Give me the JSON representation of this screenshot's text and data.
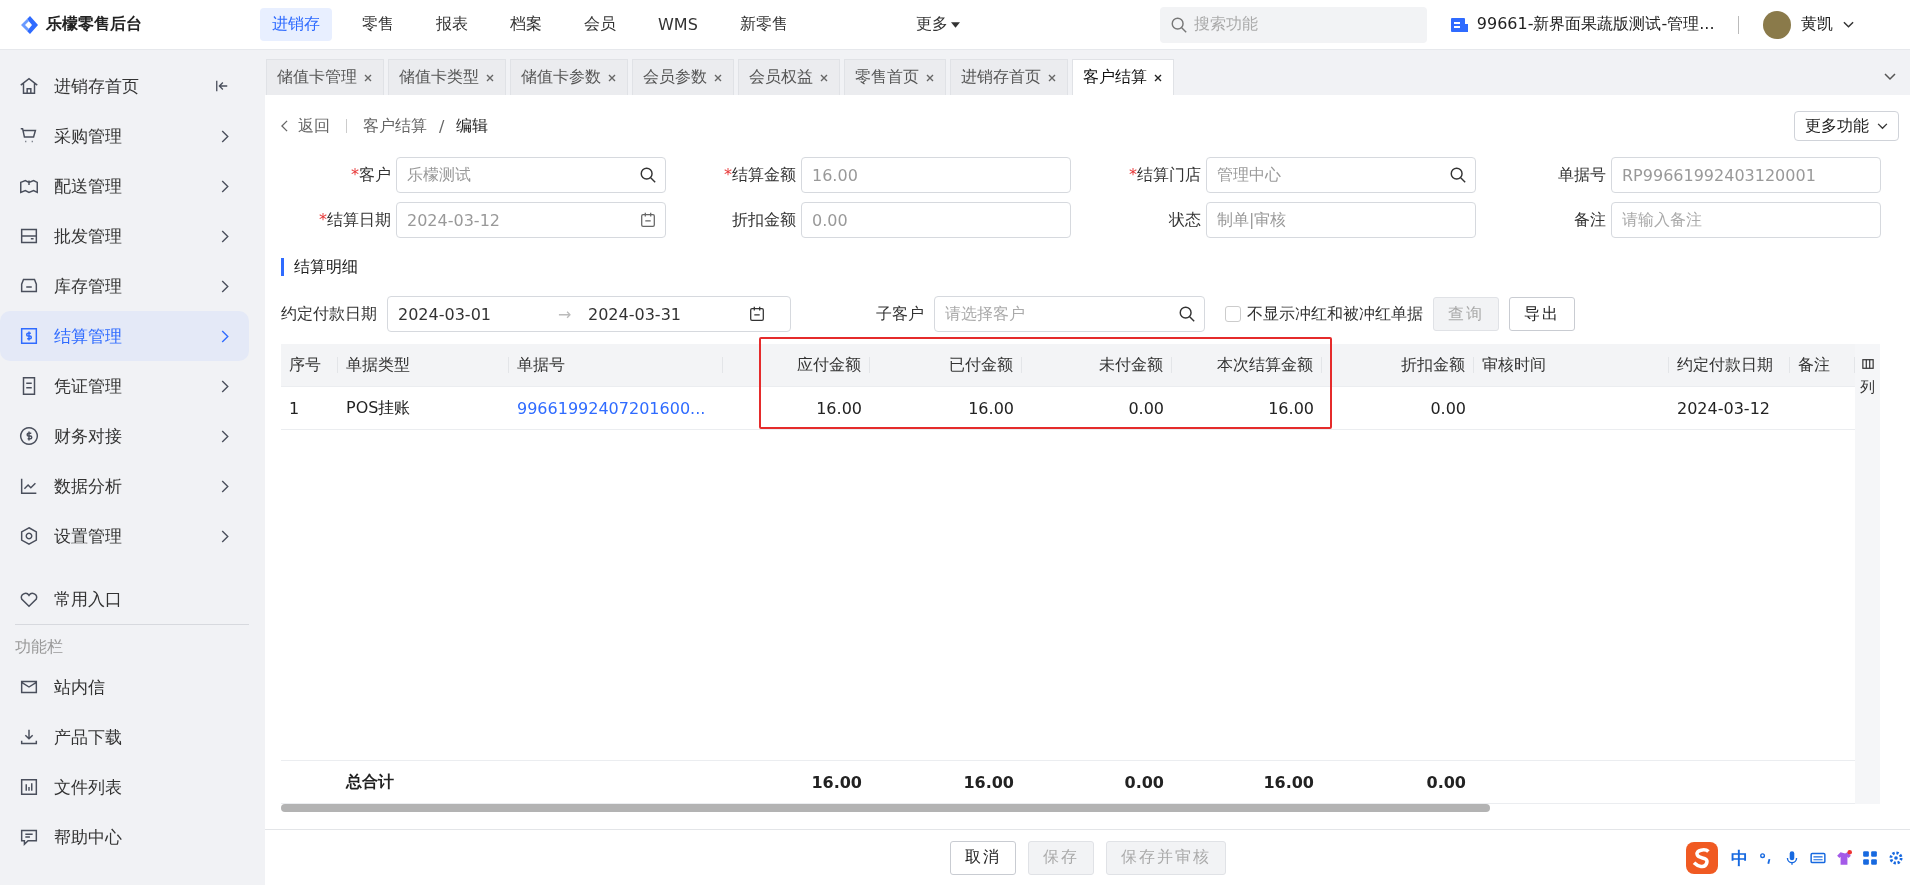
{
  "app": {
    "name": "乐檬零售后台"
  },
  "nav": [
    {
      "label": "进销存",
      "selected": true
    },
    {
      "label": "零售",
      "selected": false
    },
    {
      "label": "报表",
      "selected": false
    },
    {
      "label": "档案",
      "selected": false
    },
    {
      "label": "会员",
      "selected": false
    },
    {
      "label": "WMS",
      "selected": false
    },
    {
      "label": "新零售",
      "selected": false
    }
  ],
  "nav_more": "更多",
  "search": {
    "placeholder": "搜索功能"
  },
  "store": "99661-新界面果蔬版测试-管理...",
  "user": "黄凯",
  "tabs": [
    {
      "label": "储值卡管理",
      "selected": false
    },
    {
      "label": "储值卡类型",
      "selected": false
    },
    {
      "label": "储值卡参数",
      "selected": false
    },
    {
      "label": "会员参数",
      "selected": false
    },
    {
      "label": "会员权益",
      "selected": false
    },
    {
      "label": "零售首页",
      "selected": false
    },
    {
      "label": "进销存首页",
      "selected": false
    },
    {
      "label": "客户结算",
      "selected": true
    }
  ],
  "sidebar": {
    "home": "进销存首页",
    "items": [
      {
        "label": "采购管理",
        "selected": false
      },
      {
        "label": "配送管理",
        "selected": false
      },
      {
        "label": "批发管理",
        "selected": false
      },
      {
        "label": "库存管理",
        "selected": false
      },
      {
        "label": "结算管理",
        "selected": true
      },
      {
        "label": "凭证管理",
        "selected": false
      },
      {
        "label": "财务对接",
        "selected": false
      },
      {
        "label": "数据分析",
        "selected": false
      },
      {
        "label": "设置管理",
        "selected": false
      }
    ],
    "favorites": "常用入口",
    "tools_heading": "功能栏",
    "tools": [
      "站内信",
      "产品下载",
      "文件列表",
      "帮助中心"
    ]
  },
  "breadcrumb": {
    "back": "返回",
    "path": "客户结算",
    "separator": "/",
    "current": "编辑"
  },
  "more_button": "更多功能",
  "required_mark": "*",
  "form": [
    {
      "label": "客户",
      "required": true,
      "kind": "search",
      "value": "乐檬测试"
    },
    {
      "label": "结算金额",
      "required": true,
      "kind": "text",
      "value": "16.00"
    },
    {
      "label": "结算门店",
      "required": true,
      "kind": "search",
      "value": "管理中心"
    },
    {
      "label": "单据号",
      "required": false,
      "kind": "text",
      "value": "RP99661992403120001"
    },
    {
      "label": "结算日期",
      "required": true,
      "kind": "date",
      "value": "2024-03-12"
    },
    {
      "label": "折扣金额",
      "required": false,
      "kind": "text",
      "value": "0.00"
    },
    {
      "label": "状态",
      "required": false,
      "kind": "text",
      "value": "制单|审核"
    },
    {
      "label": "备注",
      "required": false,
      "kind": "text",
      "placeholder": "请输入备注"
    }
  ],
  "section_title": "结算明细",
  "filter": {
    "date_label": "约定付款日期",
    "date_from": "2024-03-01",
    "arrow": "→",
    "date_to": "2024-03-31",
    "sub_customer_label": "子客户",
    "sub_customer_placeholder": "请选择客户",
    "checkbox": {
      "label": "不显示冲红和被冲红单据",
      "checked": false
    },
    "buttons": [
      {
        "label": "查询",
        "disabled": true
      },
      {
        "label": "导出",
        "disabled": false
      }
    ]
  },
  "table": {
    "columns": [
      {
        "label": "序号",
        "kind": "text"
      },
      {
        "label": "单据类型",
        "kind": "text"
      },
      {
        "label": "单据号",
        "kind": "link"
      },
      {
        "label": "应付金额",
        "kind": "amount"
      },
      {
        "label": "已付金额",
        "kind": "amount"
      },
      {
        "label": "未付金额",
        "kind": "amount"
      },
      {
        "label": "本次结算金额",
        "kind": "amount"
      },
      {
        "label": "折扣金额",
        "kind": "amount"
      },
      {
        "label": "审核时间",
        "kind": "text"
      },
      {
        "label": "约定付款日期",
        "kind": "text"
      },
      {
        "label": "备注",
        "kind": "text"
      }
    ],
    "rows": [
      {
        "cells": [
          "1",
          "POS挂账",
          "99661992407201600...",
          "16.00",
          "16.00",
          "0.00",
          "16.00",
          "0.00",
          null,
          "2024-03-12",
          null
        ]
      }
    ],
    "totals": {
      "cells": [
        null,
        "总合计",
        null,
        "16.00",
        "16.00",
        "0.00",
        "16.00",
        "0.00",
        null,
        null,
        null
      ]
    },
    "column_settings": "列"
  },
  "footer_buttons": [
    {
      "label": "取消",
      "disabled": false
    },
    {
      "label": "保存",
      "disabled": true
    },
    {
      "label": "保存并审核",
      "disabled": true
    }
  ],
  "ime": {
    "label": "中"
  }
}
